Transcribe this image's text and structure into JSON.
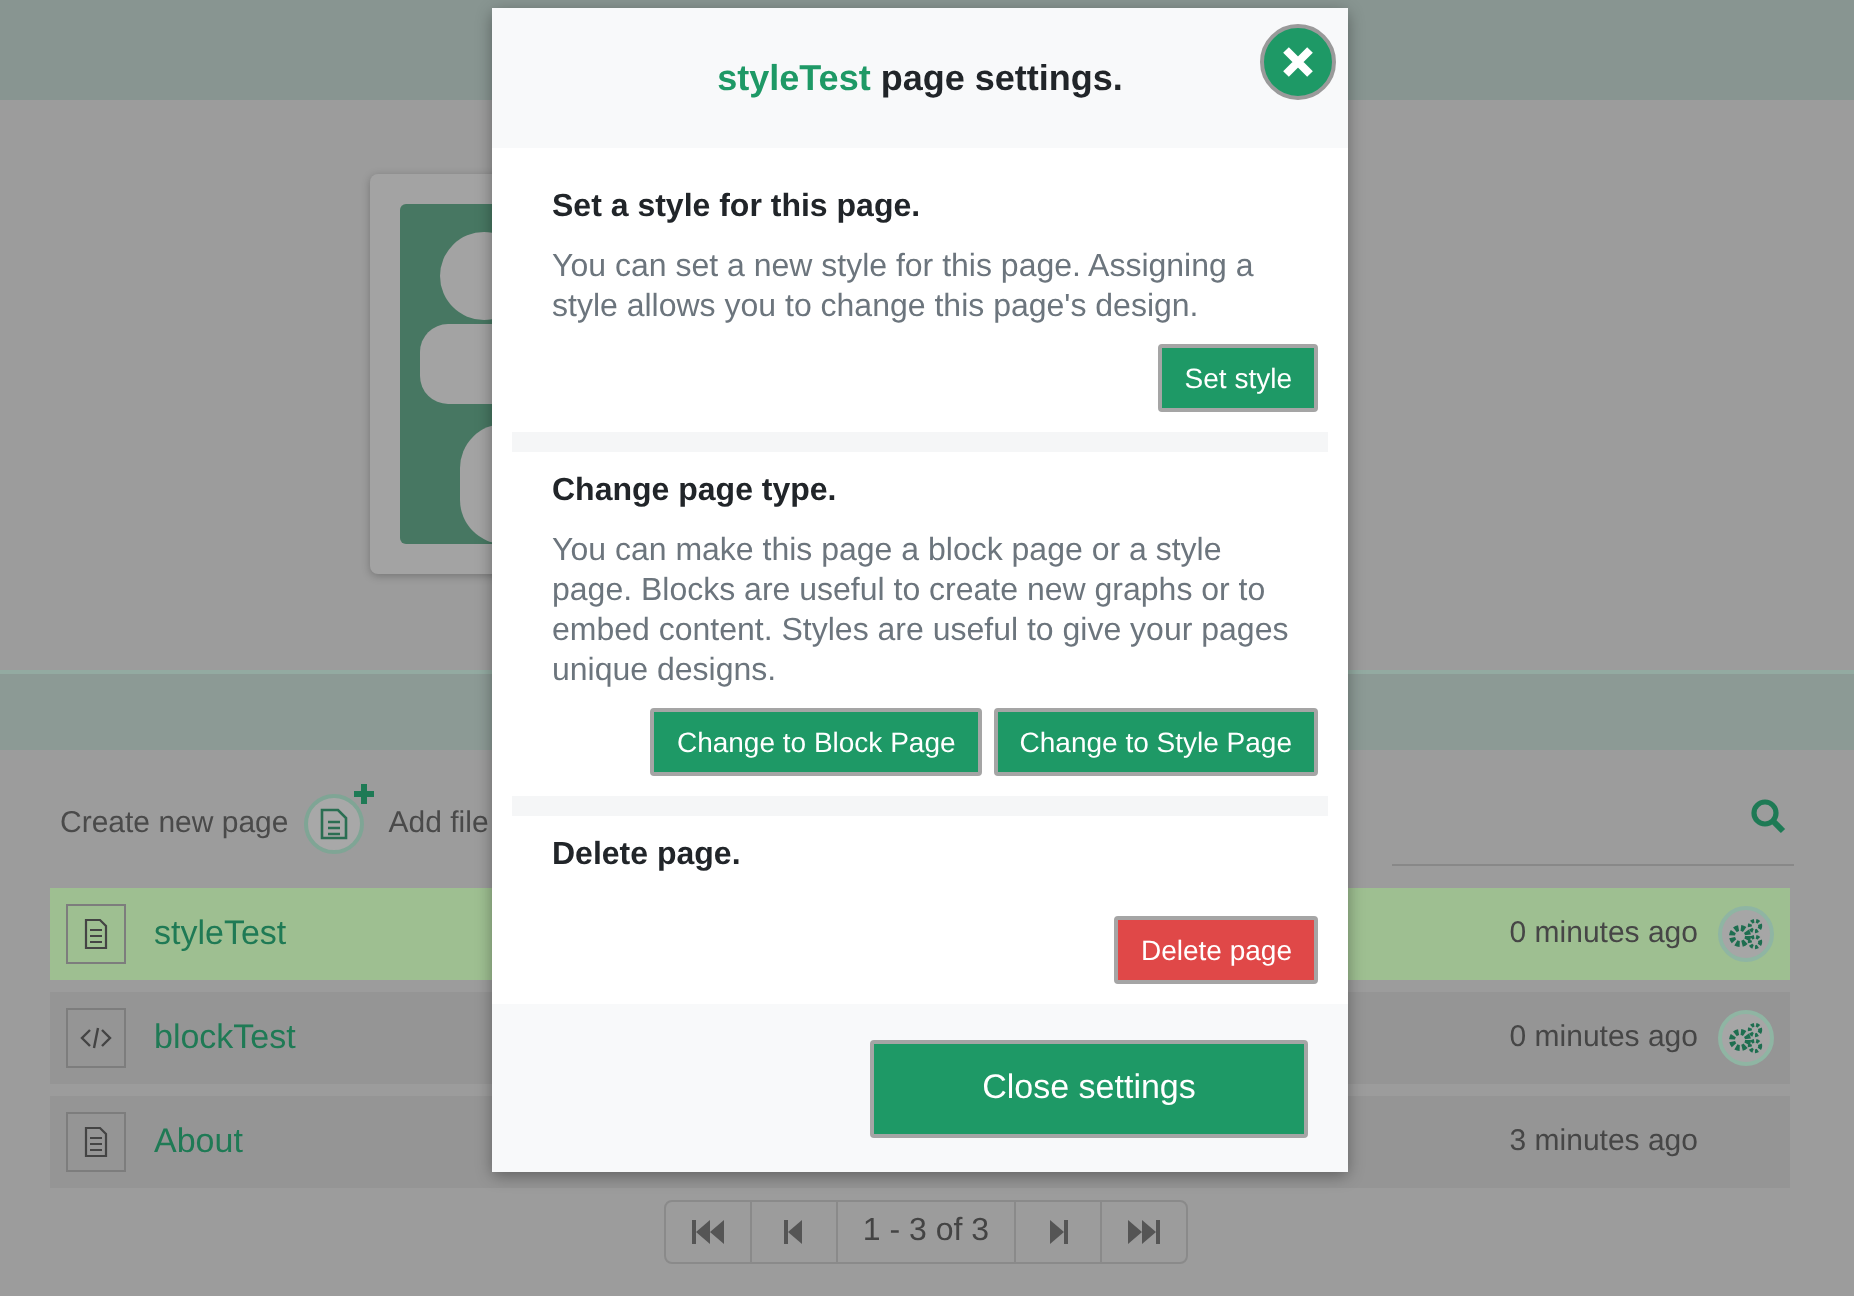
{
  "toolbar": {
    "create_label": "Create new page",
    "add_file_label": "Add file"
  },
  "pages": [
    {
      "name": "styleTest",
      "kind": "document",
      "time": "0 minutes ago",
      "selected": true,
      "settings": true
    },
    {
      "name": "blockTest",
      "kind": "code",
      "time": "0 minutes ago",
      "selected": false,
      "settings": true
    },
    {
      "name": "About",
      "kind": "document",
      "time": "3 minutes ago",
      "selected": false,
      "settings": false
    }
  ],
  "pagination": {
    "label": "1 - 3 of 3"
  },
  "modal": {
    "page_name": "styleTest",
    "title_rest": "page settings.",
    "sections": [
      {
        "heading": "Set a style for this page.",
        "text": "You can set a new style for this page. Assigning a style allows you to change this page's design.",
        "buttons": [
          {
            "label": "Set style",
            "kind": "primary"
          }
        ]
      },
      {
        "heading": "Change page type.",
        "text": "You can make this page a block page or a style page. Blocks are useful to create new graphs or to embed content. Styles are useful to give your pages unique designs.",
        "buttons": [
          {
            "label": "Change to Block Page",
            "kind": "primary"
          },
          {
            "label": "Change to Style Page",
            "kind": "primary"
          }
        ]
      },
      {
        "heading": "Delete page.",
        "buttons": [
          {
            "label": "Delete page",
            "kind": "danger"
          }
        ]
      }
    ],
    "close_button": "Close settings"
  }
}
